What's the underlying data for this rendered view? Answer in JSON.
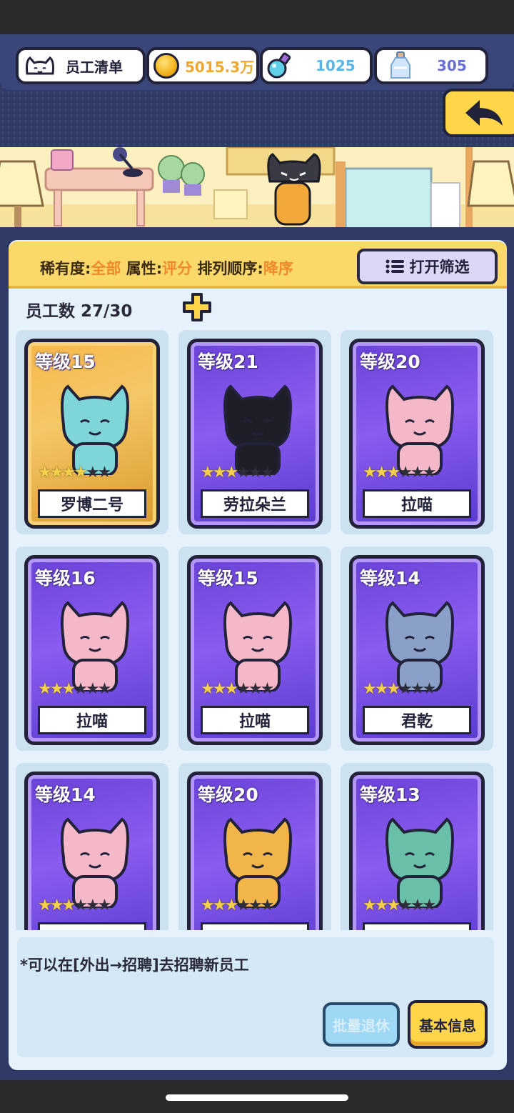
{
  "header": {
    "title": "员工清单",
    "coins": "5015.3万",
    "potion": "1025",
    "bottle": "305",
    "colors": {
      "coins": "#f0a830",
      "potion": "#5ab6e8",
      "bottle": "#6a6fd8"
    }
  },
  "filter": {
    "rarity_label": "稀有度:",
    "rarity_value": "全部",
    "attr_label": "属性:",
    "attr_value": "评分",
    "order_label": "排列顺序:",
    "order_value": "降序",
    "open_button": "打开筛选"
  },
  "staff_count": {
    "label": "员工数",
    "value": "27/30"
  },
  "cards": [
    {
      "level": "等级15",
      "name": "罗博二号",
      "stars": 4,
      "rarity": "gold"
    },
    {
      "level": "等级21",
      "name": "劳拉朵兰",
      "stars": 3,
      "rarity": "purple"
    },
    {
      "level": "等级20",
      "name": "拉喵",
      "stars": 3,
      "rarity": "purple"
    },
    {
      "level": "等级16",
      "name": "拉喵",
      "stars": 3,
      "rarity": "purple"
    },
    {
      "level": "等级15",
      "name": "拉喵",
      "stars": 3,
      "rarity": "purple"
    },
    {
      "level": "等级14",
      "name": "君乾",
      "stars": 3,
      "rarity": "purple"
    },
    {
      "level": "等级14",
      "name": "",
      "stars": 3,
      "rarity": "purple"
    },
    {
      "level": "等级20",
      "name": "",
      "stars": 3,
      "rarity": "purple"
    },
    {
      "level": "等级13",
      "name": "",
      "stars": 3,
      "rarity": "purple"
    }
  ],
  "hint": "*可以在[外出→招聘]去招聘新员工",
  "buttons": {
    "retire": "批量退休",
    "info": "基本信息"
  }
}
